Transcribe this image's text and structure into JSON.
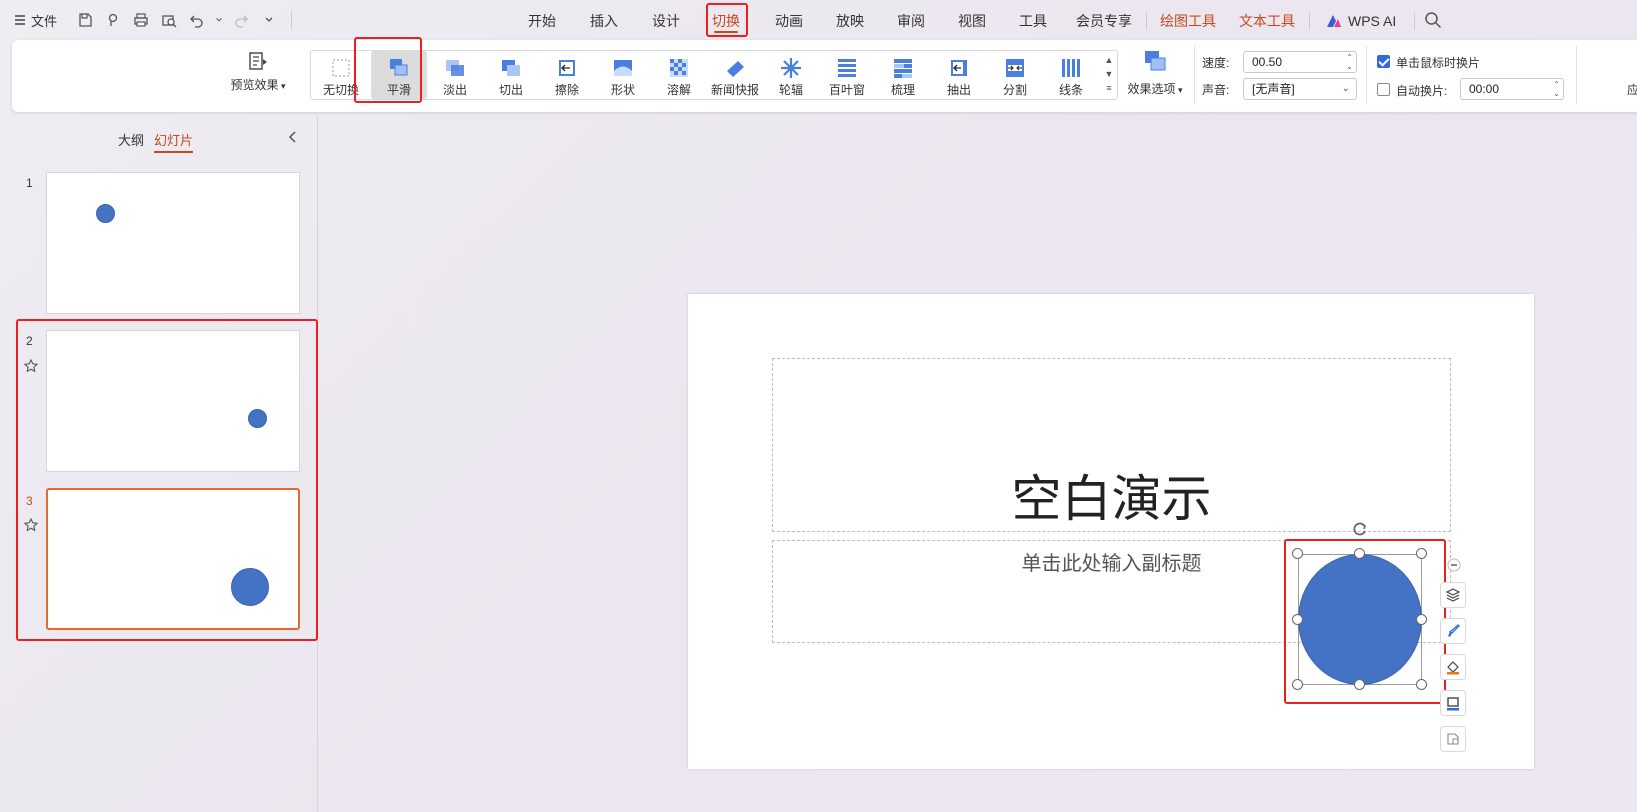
{
  "menubar": {
    "file_label": "文件",
    "tabs": {
      "home": "开始",
      "insert": "插入",
      "design": "设计",
      "transition": "切换",
      "animation": "动画",
      "slideshow": "放映",
      "review": "审阅",
      "view": "视图",
      "tools": "工具",
      "member": "会员专享",
      "drawing_tools": "绘图工具",
      "text_tools": "文本工具",
      "wps_ai": "WPS AI"
    }
  },
  "ribbon": {
    "preview_label": "预览效果",
    "transitions": [
      {
        "label": "无切换",
        "icon": "no-transition-icon"
      },
      {
        "label": "平滑",
        "icon": "smooth-icon"
      },
      {
        "label": "淡出",
        "icon": "fade-icon"
      },
      {
        "label": "切出",
        "icon": "cut-icon"
      },
      {
        "label": "擦除",
        "icon": "wipe-icon"
      },
      {
        "label": "形状",
        "icon": "shape-icon"
      },
      {
        "label": "溶解",
        "icon": "dissolve-icon"
      },
      {
        "label": "新闻快报",
        "icon": "newsflash-icon"
      },
      {
        "label": "轮辐",
        "icon": "wheel-icon"
      },
      {
        "label": "百叶窗",
        "icon": "blinds-icon"
      },
      {
        "label": "梳理",
        "icon": "comb-icon"
      },
      {
        "label": "抽出",
        "icon": "pull-icon"
      },
      {
        "label": "分割",
        "icon": "split-icon"
      },
      {
        "label": "线条",
        "icon": "lines-icon"
      }
    ],
    "selected_transition": "平滑",
    "effect_options_label": "效果选项",
    "speed_label": "速度:",
    "speed_value": "00.50",
    "sound_label": "声音:",
    "sound_value": "[无声音]",
    "click_advance_label": "单击鼠标时换片",
    "click_advance_checked": true,
    "auto_advance_label": "自动换片:",
    "auto_advance_checked": false,
    "auto_advance_value": "00:00",
    "apply_partial": "应"
  },
  "left_panel": {
    "outline_tab": "大纲",
    "slides_tab": "幻灯片",
    "slides": [
      {
        "number": "1",
        "has_transition": false
      },
      {
        "number": "2",
        "has_transition": true
      },
      {
        "number": "3",
        "has_transition": true
      }
    ]
  },
  "slide": {
    "title": "空白演示",
    "subtitle_placeholder": "单击此处输入副标题"
  },
  "colors": {
    "accent": "#c8481c",
    "shape_fill": "#4472c4",
    "highlight": "#e8201f",
    "checkbox": "#2f6bdc"
  }
}
